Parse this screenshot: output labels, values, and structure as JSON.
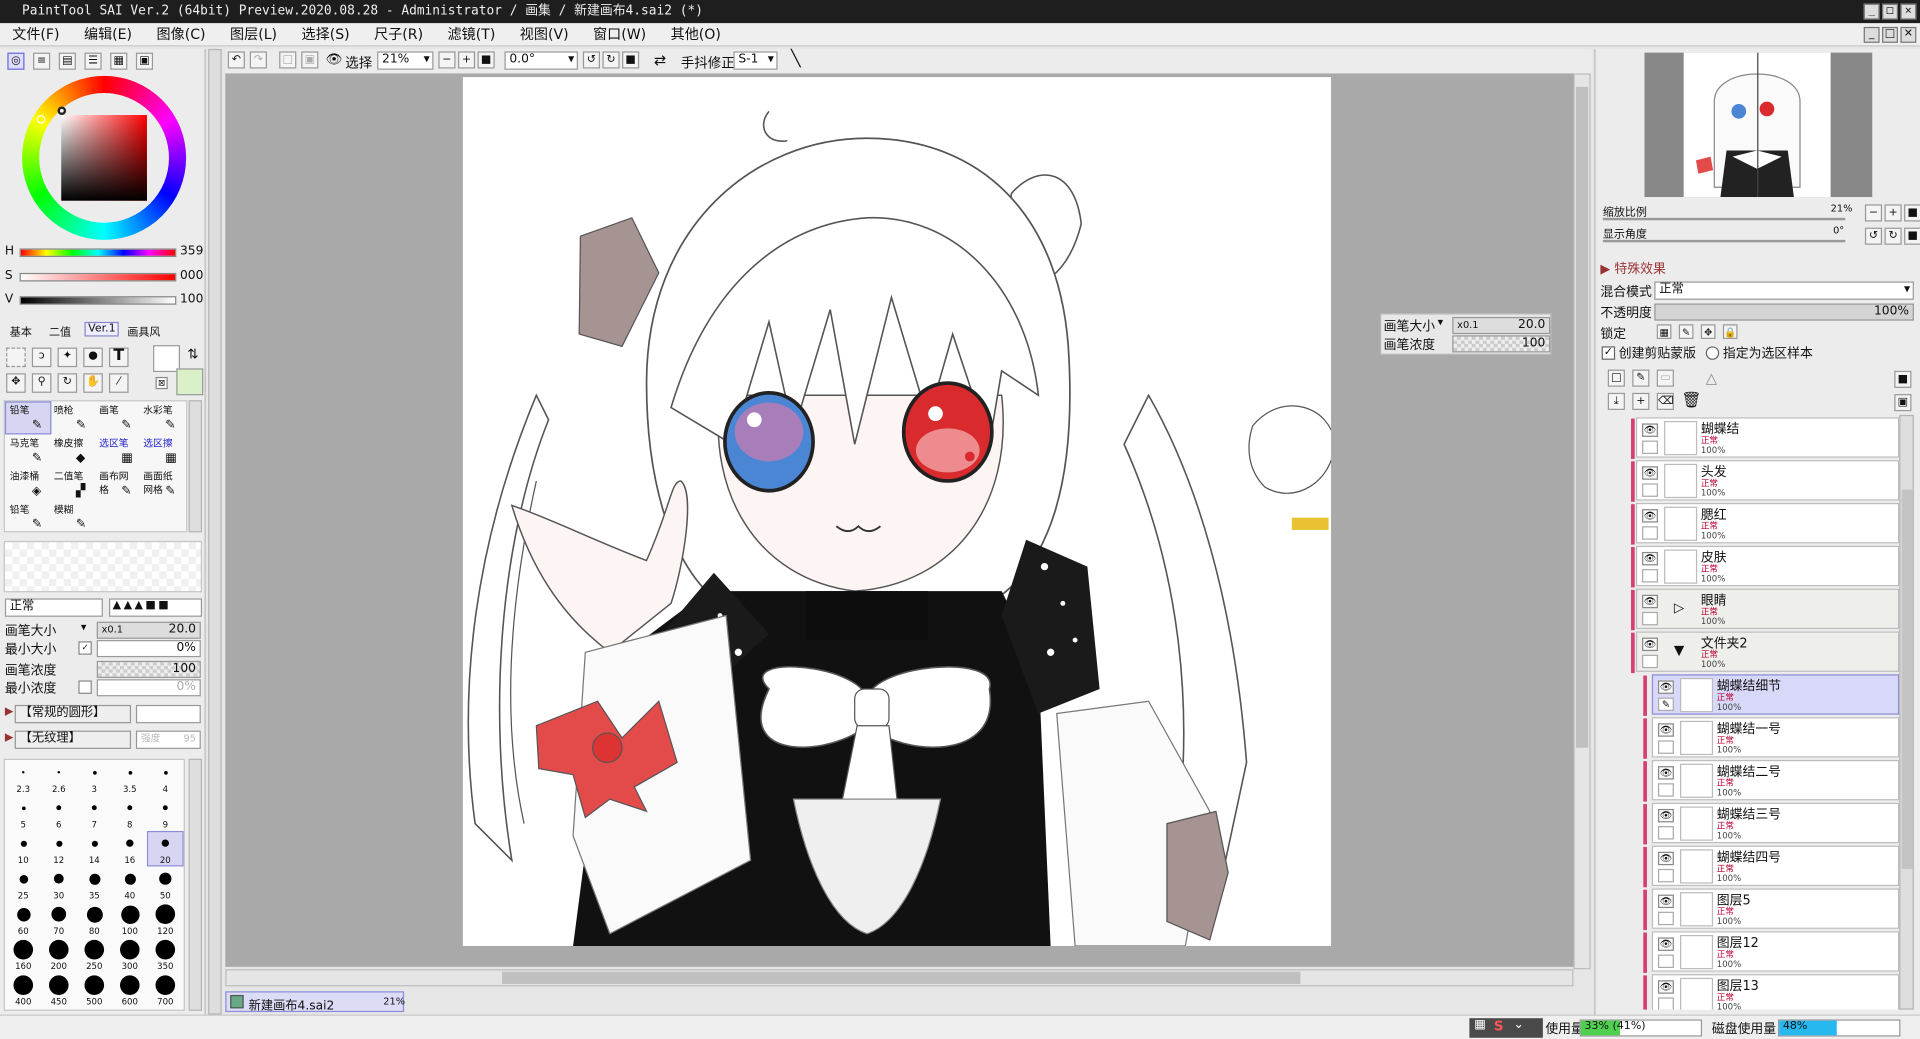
{
  "app": {
    "title": "PaintTool SAI Ver.2 (64bit) Preview.2020.08.28 - Administrator / 画集 / 新建画布4.sai2 (*)"
  },
  "menu": [
    "文件(F)",
    "编辑(E)",
    "图像(C)",
    "图层(L)",
    "选择(S)",
    "尺子(R)",
    "滤镜(T)",
    "视图(V)",
    "窗口(W)",
    "其他(O)"
  ],
  "toolbar": {
    "select_label": "选择",
    "zoom": "21%",
    "rotation": "0.0°",
    "stabilizer_label": "手抖修正",
    "stabilizer": "S-1"
  },
  "color": {
    "h_label": "H",
    "s_label": "S",
    "v_label": "V",
    "h": "359",
    "s": "000",
    "v": "100",
    "primary": "#ffffff",
    "secondary": "#d9f0c9"
  },
  "color_tabs": [
    "基本",
    "二值",
    "Ver.1",
    "画具风"
  ],
  "tools": [
    "铅笔",
    "喷枪",
    "画笔",
    "水彩笔",
    "马克笔",
    "橡皮擦",
    "选区笔",
    "选区擦",
    "油漆桶",
    "二值笔",
    "画布网格",
    "画面纸网格",
    "铅笔",
    "模糊"
  ],
  "brush_settings": {
    "mode": "正常",
    "size_label": "画笔大小",
    "size_mult": "x0.1",
    "size": "20.0",
    "min_size_label": "最小大小",
    "min_size": "0%",
    "density_label": "画笔浓度",
    "density": "100",
    "min_density_label": "最小浓度",
    "min_density": "0%",
    "shape": "【常规的圆形】",
    "texture": "【无纹理】",
    "texture_strength": "强度",
    "texture_value": "95"
  },
  "brush_sizes": [
    "2.3",
    "2.6",
    "3",
    "3.5",
    "4",
    "5",
    "6",
    "7",
    "8",
    "9",
    "10",
    "12",
    "14",
    "16",
    "20",
    "25",
    "30",
    "35",
    "40",
    "50",
    "60",
    "70",
    "80",
    "100",
    "120",
    "160",
    "200",
    "250",
    "300",
    "350",
    "400",
    "450",
    "500",
    "600",
    "700"
  ],
  "selected_brush_size": "20",
  "floating_panel": {
    "size_label": "画笔大小",
    "size_mult": "x0.1",
    "size": "20.0",
    "density_label": "画笔浓度",
    "density": "100"
  },
  "navigator": {
    "zoom_label": "缩放比例",
    "zoom": "21%",
    "angle_label": "显示角度",
    "angle": "0°"
  },
  "layer_props": {
    "effects_label": "特殊效果",
    "blend_label": "混合模式",
    "blend": "正常",
    "opacity_label": "不透明度",
    "opacity": "100%",
    "lock_label": "锁定",
    "clip_label": "创建剪贴蒙版",
    "sample_label": "指定为选区样本"
  },
  "layers": [
    {
      "name": "蝴蝶结",
      "mode": "正常",
      "opacity": "100%",
      "type": "layer",
      "indent": false
    },
    {
      "name": "头发",
      "mode": "正常",
      "opacity": "100%",
      "type": "layer",
      "indent": false
    },
    {
      "name": "腮红",
      "mode": "正常",
      "opacity": "100%",
      "type": "layer",
      "indent": false
    },
    {
      "name": "皮肤",
      "mode": "正常",
      "opacity": "100%",
      "type": "layer",
      "indent": false
    },
    {
      "name": "眼睛",
      "mode": "正常",
      "opacity": "100%",
      "type": "folder",
      "indent": false
    },
    {
      "name": "文件夹2",
      "mode": "正常",
      "opacity": "100%",
      "type": "folder-open",
      "indent": false
    },
    {
      "name": "蝴蝶结细节",
      "mode": "正常",
      "opacity": "100%",
      "type": "layer",
      "indent": true,
      "selected": true
    },
    {
      "name": "蝴蝶结一号",
      "mode": "正常",
      "opacity": "100%",
      "type": "layer",
      "indent": true
    },
    {
      "name": "蝴蝶结二号",
      "mode": "正常",
      "opacity": "100%",
      "type": "layer",
      "indent": true
    },
    {
      "name": "蝴蝶结三号",
      "mode": "正常",
      "opacity": "100%",
      "type": "layer",
      "indent": true
    },
    {
      "name": "蝴蝶结四号",
      "mode": "正常",
      "opacity": "100%",
      "type": "layer",
      "indent": true
    },
    {
      "name": "图层5",
      "mode": "正常",
      "opacity": "100%",
      "type": "layer",
      "indent": true
    },
    {
      "name": "图层12",
      "mode": "正常",
      "opacity": "100%",
      "type": "layer",
      "indent": true
    },
    {
      "name": "图层13",
      "mode": "正常",
      "opacity": "100%",
      "type": "layer",
      "indent": true
    }
  ],
  "document_tab": {
    "name": "新建画布4.sai2",
    "zoom": "21%"
  },
  "status": {
    "mem_label": "使用量",
    "mem": "33% (41%)",
    "disk_label": "磁盘使用量",
    "disk": "48%"
  }
}
